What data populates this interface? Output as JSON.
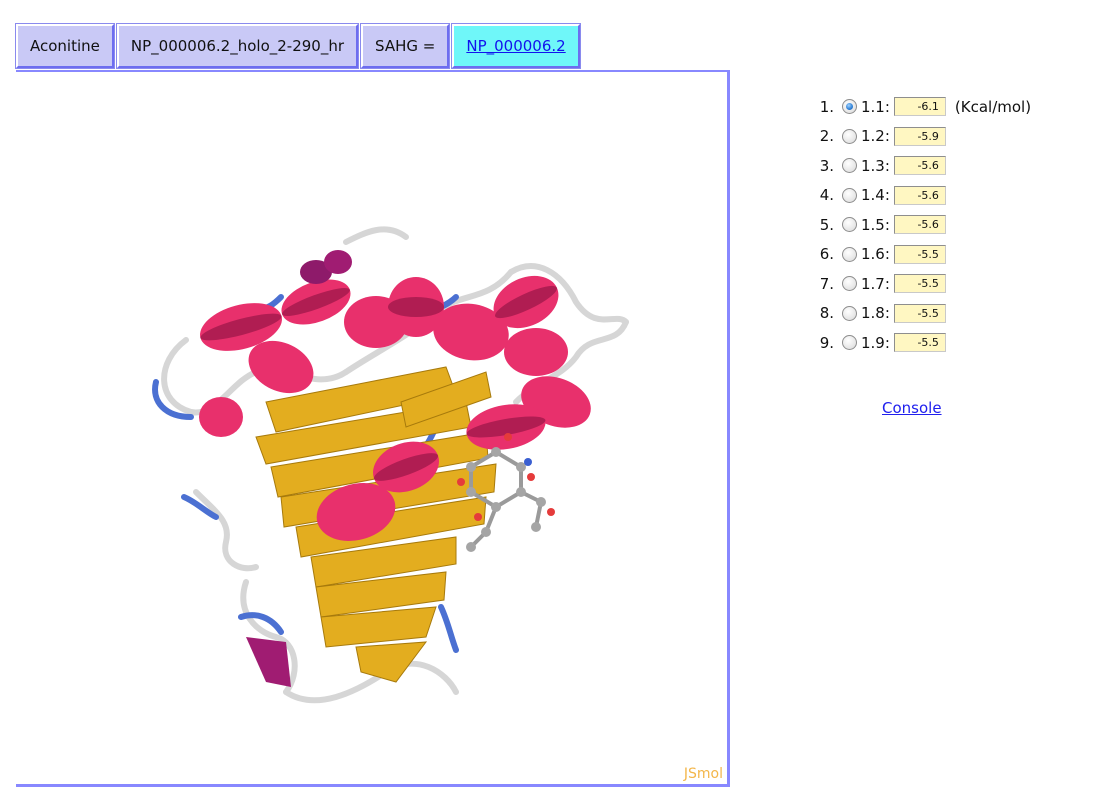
{
  "tabs": [
    {
      "label": "Aconitine"
    },
    {
      "label": "NP_000006.2_holo_2-290_hr"
    },
    {
      "label": "SAHG ="
    },
    {
      "label": "NP_000006.2"
    }
  ],
  "viewer": {
    "brand_label": "JSmol"
  },
  "docking_scores": {
    "unit": "(Kcal/mol)",
    "selected_index": 0,
    "rows": [
      {
        "num": "1.",
        "model": "1.1:",
        "score": "-6.1"
      },
      {
        "num": "2.",
        "model": "1.2:",
        "score": "-5.9"
      },
      {
        "num": "3.",
        "model": "1.3:",
        "score": "-5.6"
      },
      {
        "num": "4.",
        "model": "1.4:",
        "score": "-5.6"
      },
      {
        "num": "5.",
        "model": "1.5:",
        "score": "-5.6"
      },
      {
        "num": "6.",
        "model": "1.6:",
        "score": "-5.5"
      },
      {
        "num": "7.",
        "model": "1.7:",
        "score": "-5.5"
      },
      {
        "num": "8.",
        "model": "1.8:",
        "score": "-5.5"
      },
      {
        "num": "9.",
        "model": "1.9:",
        "score": "-5.5"
      }
    ]
  },
  "console_link": "Console",
  "colors": {
    "tab_bg": "#c9c9f6",
    "tab_active_bg": "#6ff7f9",
    "viewer_border": "#8888ff",
    "helix": "#e8306c",
    "sheet": "#e3ad1f",
    "coil": "#cfcfcf",
    "turn": "#4b70d2",
    "score_box_bg": "#fff7c2"
  }
}
